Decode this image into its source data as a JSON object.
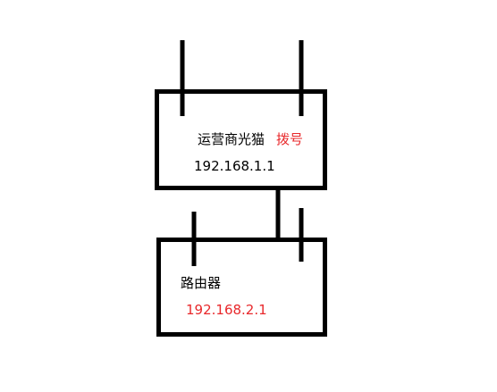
{
  "colors": {
    "line": "#000000",
    "text": "#000000",
    "highlight": "#e8282b"
  },
  "modem": {
    "name": "运营商光猫",
    "dial_label": "拨号",
    "ip": "192.168.1.1"
  },
  "router": {
    "name": "路由器",
    "ip": "192.168.2.1"
  }
}
